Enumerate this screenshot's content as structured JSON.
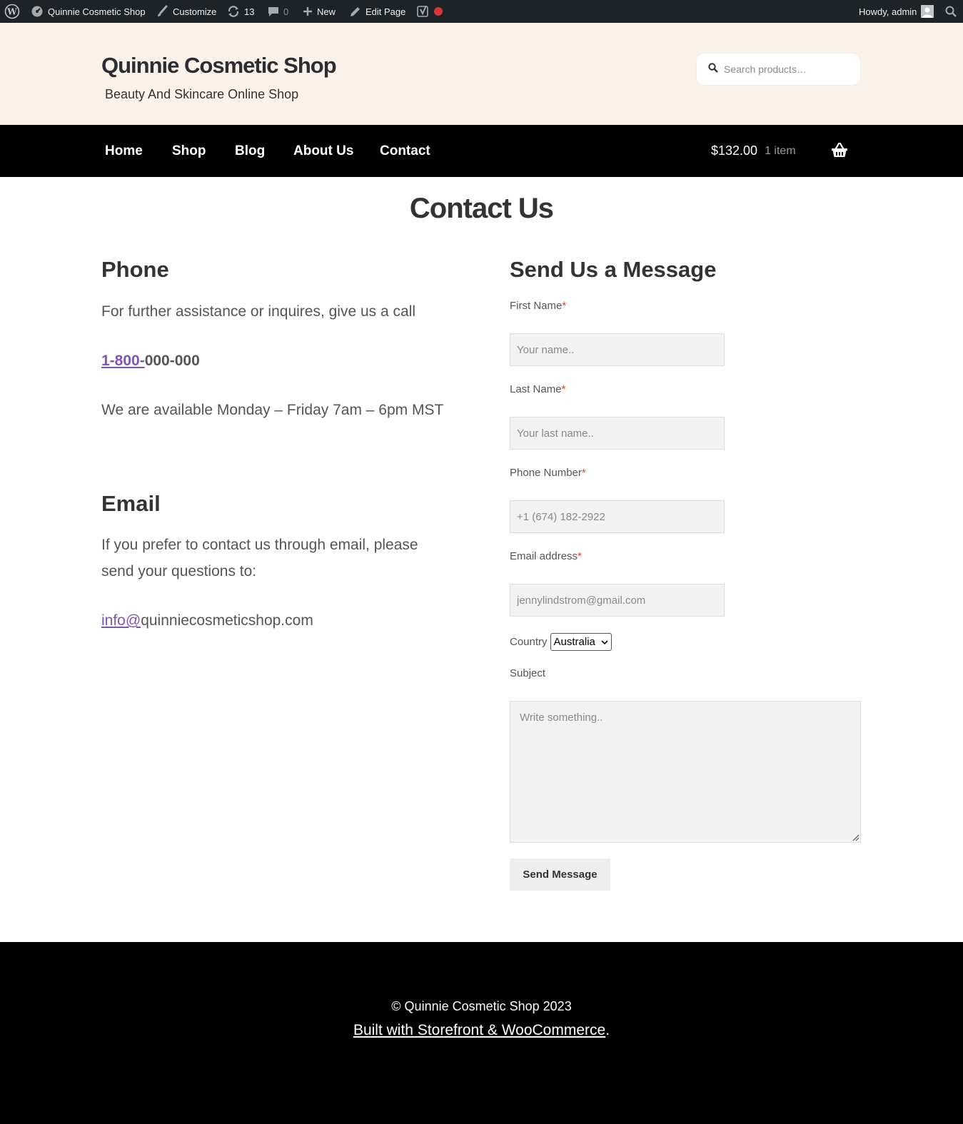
{
  "admin_bar": {
    "site_name": "Quinnie Cosmetic Shop",
    "customize": "Customize",
    "updates_count": "13",
    "comments_count": "0",
    "new": "New",
    "edit_page": "Edit Page",
    "howdy": "Howdy, admin"
  },
  "header": {
    "site_title": "Quinnie Cosmetic Shop",
    "tagline": "Beauty And Skincare Online Shop",
    "search_placeholder": "Search products…"
  },
  "nav": {
    "items": [
      "Home",
      "Shop",
      "Blog",
      "About Us",
      "Contact"
    ],
    "cart_total": "$132.00",
    "cart_count": "1 item"
  },
  "page": {
    "title": "Contact Us"
  },
  "phone_section": {
    "heading": "Phone",
    "intro": "For further assistance or inquires, give us a call",
    "phone_link": "1-800-",
    "phone_rest": "000-000",
    "availability": "We are available Monday – Friday 7am – 6pm MST"
  },
  "email_section": {
    "heading": "Email",
    "intro": "If you prefer to contact us through email, please send your questions to:",
    "email_link": "info@",
    "email_rest": "quinniecosmeticshop.com"
  },
  "form": {
    "heading": "Send Us a Message",
    "first_name_label": "First Name",
    "first_name_placeholder": "Your name..",
    "last_name_label": "Last Name",
    "last_name_placeholder": "Your last name..",
    "phone_label": "Phone Number",
    "phone_placeholder": "+1 (674) 182-2922",
    "email_label": "Email address",
    "email_placeholder": "jennylindstrom@gmail.com",
    "country_label": "Country",
    "country_value": "Australia",
    "subject_label": "Subject",
    "subject_placeholder": "Write something..",
    "required_mark": "*",
    "submit_label": "Send Message"
  },
  "footer": {
    "copyright": "© Quinnie Cosmetic Shop 2023",
    "built_with": "Built with Storefront & WooCommerce",
    "built_suffix": "."
  },
  "colors": {
    "admin_bar": "#1d2327",
    "header_bg": "#f9f1ea",
    "nav_bg": "#000000",
    "link": "#7f54b3",
    "required": "#e2401c",
    "record_dot": "#d63638"
  }
}
